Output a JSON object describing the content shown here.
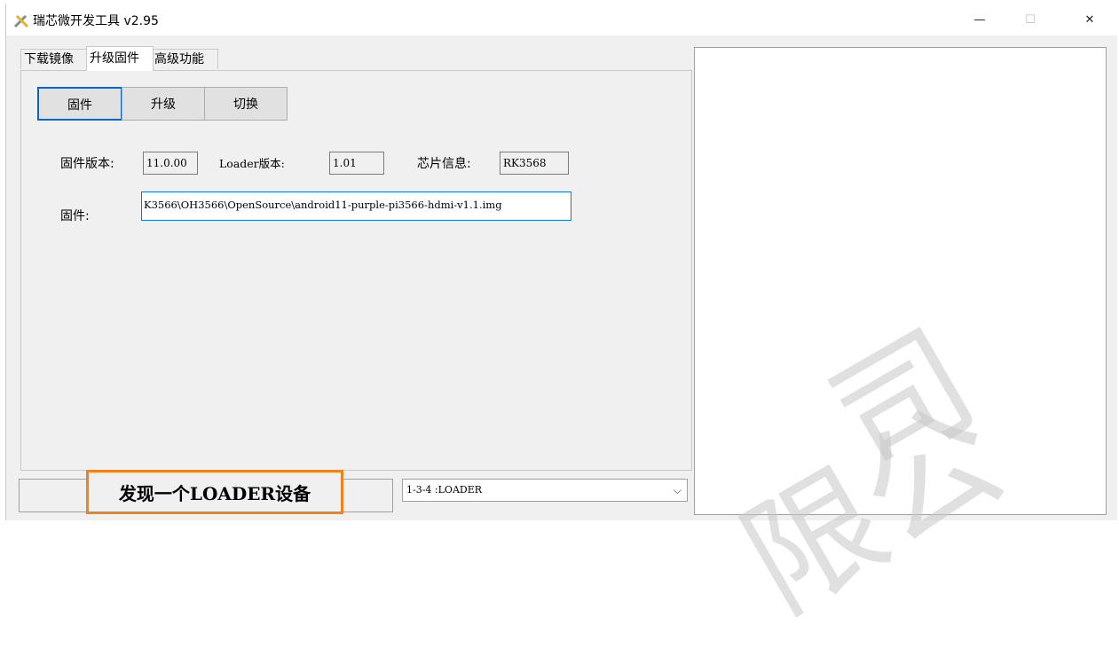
{
  "window": {
    "title": "瑞芯微开发工具 v2.95",
    "minimize_glyph": "—",
    "maximize_glyph": "☐",
    "close_glyph": "✕",
    "icon": "tools-icon"
  },
  "tabs": [
    {
      "label": "下载镜像",
      "active": false
    },
    {
      "label": "升级固件",
      "active": true
    },
    {
      "label": "高级功能",
      "active": false
    }
  ],
  "toolbar": {
    "firmware_label": "固件",
    "upgrade_label": "升级",
    "switch_label": "切换"
  },
  "info": {
    "fw_version_label": "固件版本:",
    "fw_version_value": "11.0.00",
    "loader_version_label": "Loader版本:",
    "loader_version_value": "1.01",
    "chip_label": "芯片信息:",
    "chip_value": "RK3568",
    "firmware_path_label": "固件:",
    "firmware_path_value": "K3566\\OH3566\\OpenSource\\android11-purple-pi3566-hdmi-v1.1.img"
  },
  "status": {
    "message": "发现一个LOADER设备",
    "highlight_color": "#f0821e"
  },
  "device_select": {
    "selected": "1-3-4 :LOADER",
    "chevron_icon": "chevron-down-icon"
  },
  "watermark": {
    "text_1": "司",
    "text_2": "限公"
  }
}
